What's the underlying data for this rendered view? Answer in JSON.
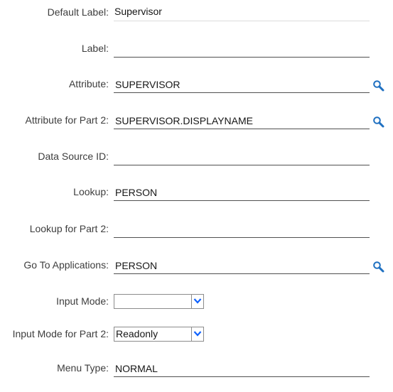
{
  "form": {
    "default_label": {
      "label": "Default Label:",
      "value": "Supervisor"
    },
    "label": {
      "label": "Label:",
      "value": ""
    },
    "attribute": {
      "label": "Attribute:",
      "value": "SUPERVISOR",
      "icon": "search-icon"
    },
    "attribute_part2": {
      "label": "Attribute for Part 2:",
      "value": "SUPERVISOR.DISPLAYNAME",
      "icon": "search-icon"
    },
    "data_source_id": {
      "label": "Data Source ID:",
      "value": ""
    },
    "lookup": {
      "label": "Lookup:",
      "value": "PERSON"
    },
    "lookup_part2": {
      "label": "Lookup for Part 2:",
      "value": ""
    },
    "go_to_applications": {
      "label": "Go To Applications:",
      "value": "PERSON",
      "icon": "search-icon"
    },
    "input_mode": {
      "label": "Input Mode:",
      "value": ""
    },
    "input_mode_part2": {
      "label": "Input Mode for Part 2:",
      "value": "Readonly"
    },
    "menu_type": {
      "label": "Menu Type:",
      "value": "NORMAL"
    }
  },
  "colors": {
    "icon": "#1f70c1",
    "dropdown_arrow": "#0f62fe",
    "field_border": "#505050"
  }
}
